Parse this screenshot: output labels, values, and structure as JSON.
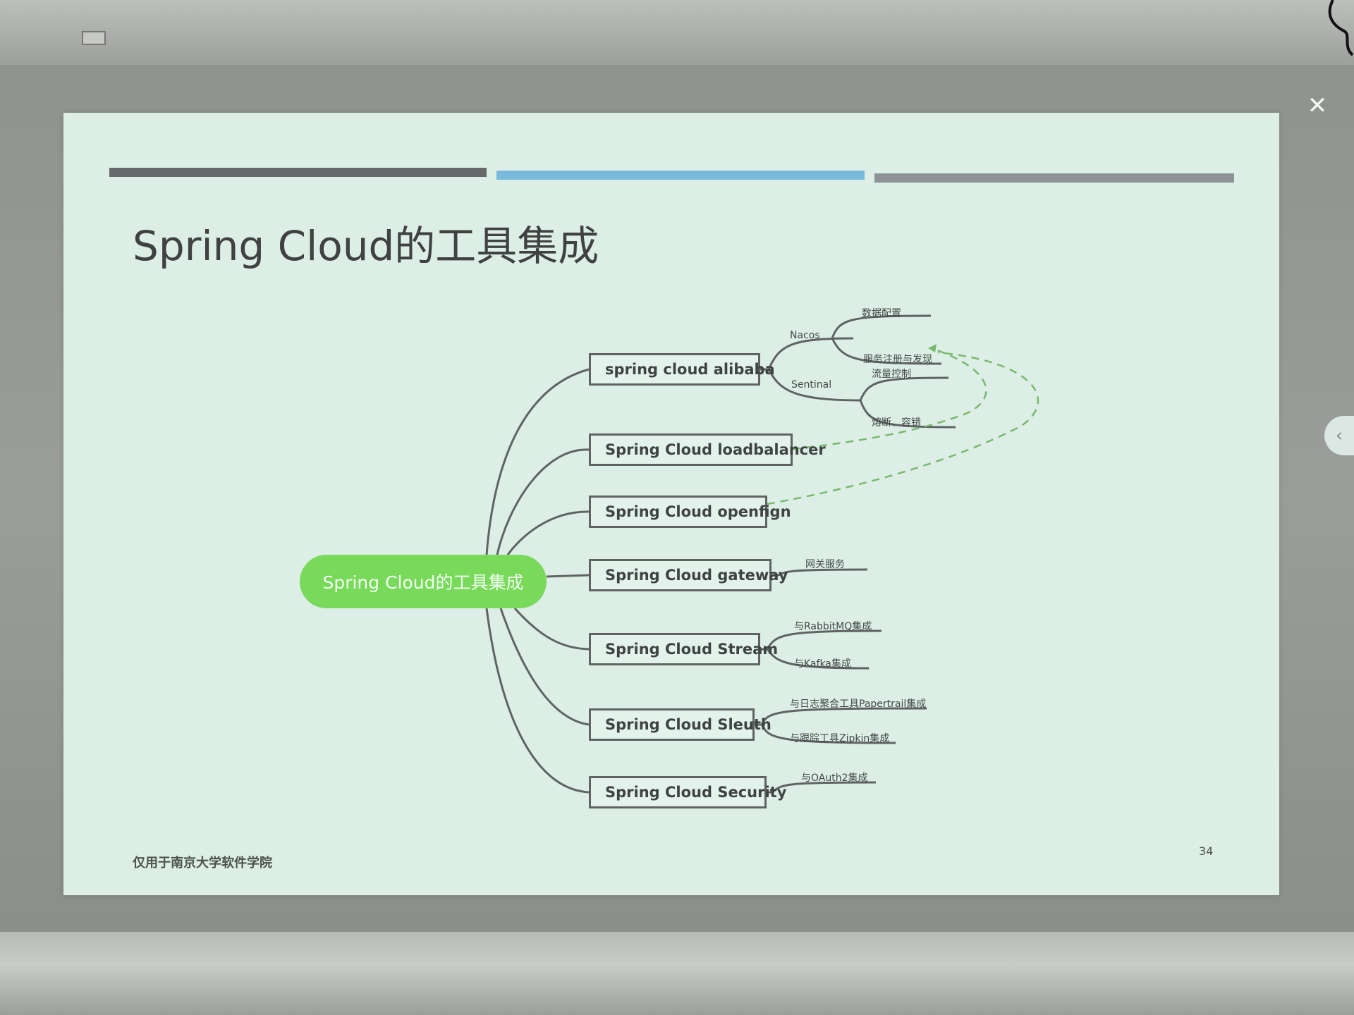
{
  "slide": {
    "title": "Spring Cloud的工具集成",
    "footer": "仅用于南京大学软件学院",
    "page_number": "34"
  },
  "mindmap": {
    "root": "Spring Cloud的工具集成",
    "branches": [
      {
        "label": "spring cloud alibaba",
        "children": [
          {
            "label": "Nacos",
            "children": [
              "数据配置",
              "服务注册与发现"
            ]
          },
          {
            "label": "Sentinal",
            "children": [
              "流量控制",
              "熔断、容错"
            ]
          }
        ]
      },
      {
        "label": "Spring Cloud loadbalancer",
        "children": []
      },
      {
        "label": "Spring Cloud openfign",
        "children": []
      },
      {
        "label": "Spring Cloud  gateway",
        "children": [
          "网关服务"
        ]
      },
      {
        "label": "Spring Cloud Stream",
        "children": [
          "与RabbitMQ集成",
          "与Kafka集成"
        ]
      },
      {
        "label": "Spring Cloud Sleuth",
        "children": [
          "与日志聚合工具Papertrail集成",
          "与跟踪工具Zipkin集成"
        ]
      },
      {
        "label": "Spring Cloud Security",
        "children": [
          "与OAuth2集成"
        ]
      }
    ]
  },
  "viewer": {
    "close_icon": "close-icon",
    "side_handle_icon": "chevron-left-icon"
  },
  "colors": {
    "slide_background": "#dceee6",
    "root_node": "#79d95a",
    "dashed_link": "#79b96c",
    "bar_dark": "#66696a",
    "bar_blue": "#79b9dc",
    "bar_gray": "#8e9296"
  }
}
